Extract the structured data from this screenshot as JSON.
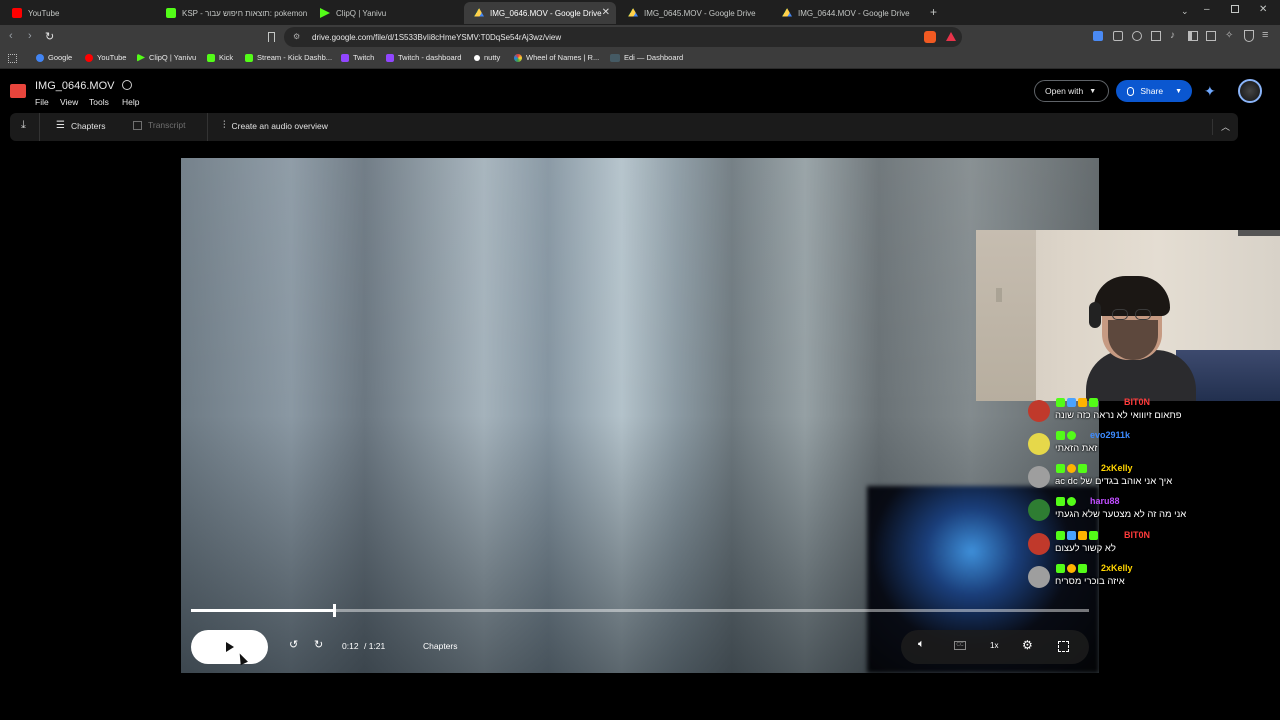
{
  "browser": {
    "tabs": [
      {
        "label": "YouTube",
        "icon": "youtube-icon",
        "color": "#ff0000"
      },
      {
        "label": "KSP - תוצאות חיפוש עבור: pokemon",
        "icon": "ksp-icon",
        "color": "#53fc18"
      },
      {
        "label": "ClipQ | Yanivu",
        "icon": "clipq-icon",
        "color": "#7c4dff"
      },
      {
        "label": "IMG_0646.MOV - Google Drive",
        "icon": "drive-icon",
        "color": "#1fa463",
        "active": true
      },
      {
        "label": "IMG_0645.MOV - Google Drive",
        "icon": "drive-icon",
        "color": "#1fa463"
      },
      {
        "label": "IMG_0644.MOV - Google Drive",
        "icon": "drive-icon",
        "color": "#1fa463"
      }
    ],
    "new_tab": "+",
    "url": "drive.google.com/file/d/1S533BvIi8cHmeYSMV:T0DqSe54rAj3wz/view",
    "bookmarks": [
      {
        "label": "Google",
        "color": "#4285f4"
      },
      {
        "label": "YouTube",
        "color": "#ff0000"
      },
      {
        "label": "ClipQ | Yanivu",
        "color": "#7c4dff"
      },
      {
        "label": "Kick",
        "color": "#53fc18"
      },
      {
        "label": "Stream - Kick Dashb...",
        "color": "#53fc18"
      },
      {
        "label": "Twitch",
        "color": "#9146ff"
      },
      {
        "label": "Twitch - dashboard",
        "color": "#9146ff"
      },
      {
        "label": "nutty",
        "color": "#ffffff"
      },
      {
        "label": "Wheel of Names | R...",
        "color": "#e53935"
      },
      {
        "label": "Edi — Dashboard",
        "color": "#455a64"
      }
    ]
  },
  "drive": {
    "file_title": "IMG_0646.MOV",
    "menu": [
      "File",
      "View",
      "Tools",
      "Help"
    ],
    "open_with": "Open with",
    "share": "Share",
    "toolbar": {
      "chapters": "Chapters",
      "transcript": "Transcript",
      "audio_overview": "Create an audio overview"
    }
  },
  "player": {
    "current_time": "0:12",
    "duration": "/ 1:21",
    "chapters": "Chapters",
    "speed": "1x",
    "progress": 0.159
  },
  "chat": [
    {
      "user": "BIT0N",
      "color": "#ff3b3b",
      "avatar": "#c0392b",
      "message": "פתאום זיווואי לא נראה כזה שונה"
    },
    {
      "user": "evo2911k",
      "color": "#3d8bff",
      "avatar": "#e6d84a",
      "message": "זאת הזאתי"
    },
    {
      "user": "2xKelly",
      "color": "#ffd400",
      "avatar": "#9e9e9e",
      "message": "איך אני אוהב בגדים של ac dc"
    },
    {
      "user": "haru88",
      "color": "#c04dff",
      "avatar": "#2e7d32",
      "message": "אני מה זה לא מצטער שלא הגעתי"
    },
    {
      "user": "BIT0N",
      "color": "#ff3b3b",
      "avatar": "#c0392b",
      "message": "לא קשור לעצום"
    },
    {
      "user": "2xKelly",
      "color": "#ffd400",
      "avatar": "#9e9e9e",
      "message": "איזה בוכרי מסריח"
    }
  ]
}
